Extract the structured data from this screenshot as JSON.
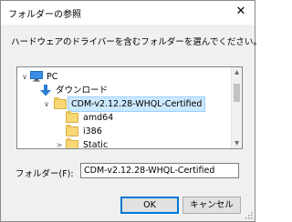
{
  "window": {
    "title": "フォルダーの参照",
    "close_glyph": "✕"
  },
  "instruction": "ハードウェアのドライバーを含むフォルダーを選んでください。",
  "tree": {
    "items": [
      {
        "label": "PC",
        "icon": "pc-icon",
        "expander": "∨"
      },
      {
        "label": "ダウンロード",
        "icon": "download-arrow-icon",
        "expander": ""
      },
      {
        "label": "CDM-v2.12.28-WHQL-Certified",
        "icon": "folder-icon",
        "expander": "∨",
        "selected": true
      },
      {
        "label": "amd64",
        "icon": "folder-icon",
        "expander": ""
      },
      {
        "label": "i386",
        "icon": "folder-icon",
        "expander": ""
      },
      {
        "label": "Static",
        "icon": "folder-icon",
        "expander": ">"
      }
    ]
  },
  "folder_field": {
    "label": "フォルダー(F):",
    "value": "CDM-v2.12.28-WHQL-Certified"
  },
  "buttons": {
    "ok": "OK",
    "cancel": "キャンセル"
  },
  "colors": {
    "selection": "#cce8ff",
    "accent": "#0078d7",
    "folder": "#f8d775"
  }
}
